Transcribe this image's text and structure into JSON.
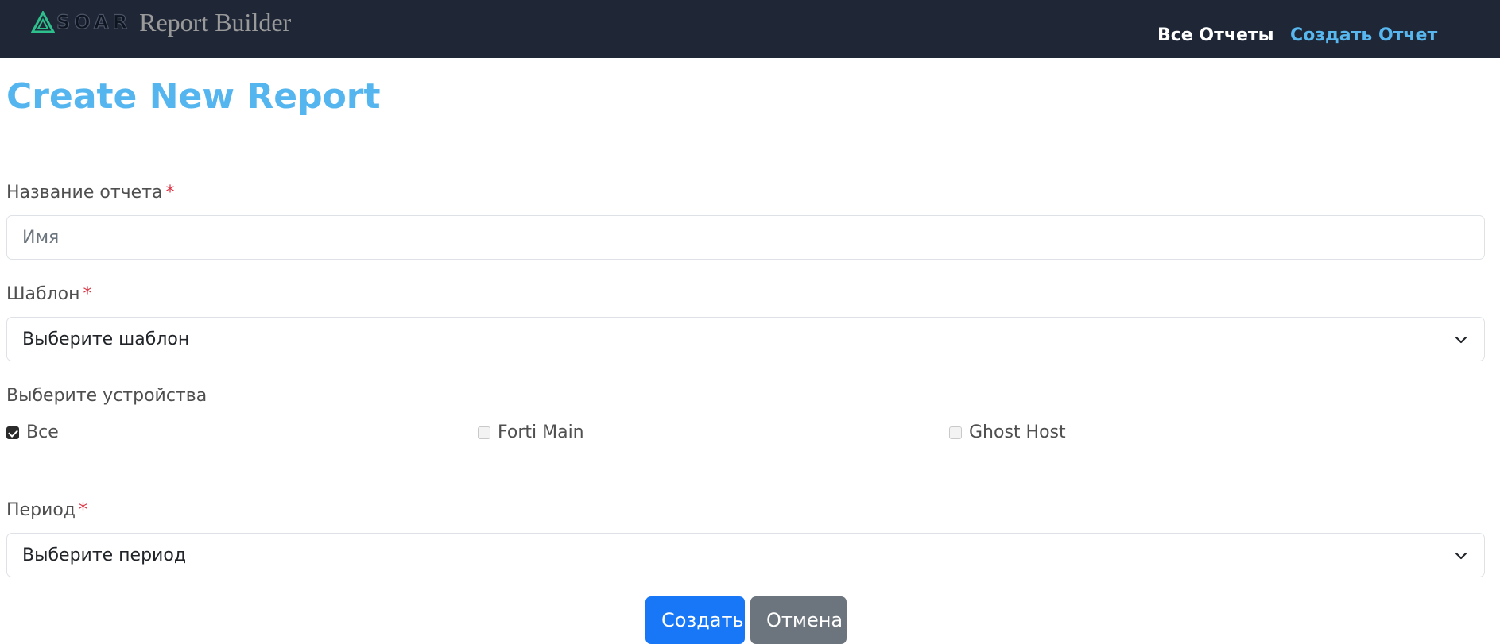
{
  "header": {
    "brand_mark": "SOAR",
    "brand_title": "Report Builder",
    "nav": {
      "all_reports": "Все Отчеты",
      "create_report": "Создать Отчет"
    },
    "colors": {
      "background": "#1f2737",
      "active_link": "#57b7ee"
    }
  },
  "page": {
    "title": "Create New Report"
  },
  "form": {
    "name": {
      "label": "Название отчета",
      "required_mark": "*",
      "placeholder": "Имя",
      "value": ""
    },
    "template": {
      "label": "Шаблон",
      "required_mark": "*",
      "selected": "Выберите шаблон"
    },
    "devices": {
      "label": "Выберите устройства",
      "options": [
        {
          "label": "Все",
          "checked": true
        },
        {
          "label": "Forti Main",
          "checked": false
        },
        {
          "label": "Ghost Host",
          "checked": false
        }
      ]
    },
    "period": {
      "label": "Период",
      "required_mark": "*",
      "selected": "Выберите период"
    },
    "buttons": {
      "submit": "Создать",
      "cancel": "Отмена"
    }
  },
  "icons": {
    "logo": "triangle-logo-icon",
    "dropdown": "chevron-down-icon",
    "checkbox_checked": "checkmark-icon"
  }
}
